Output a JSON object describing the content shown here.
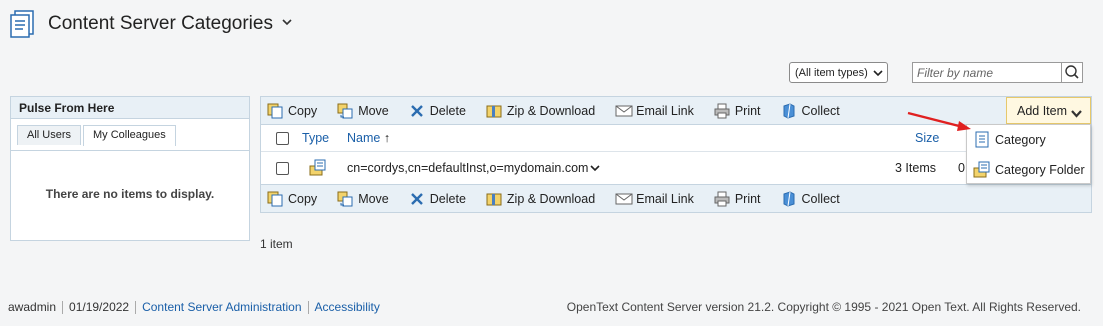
{
  "header": {
    "title": "Content Server Categories",
    "icon": "folder-page-icon"
  },
  "filters": {
    "item_types_value": "(All item types)",
    "filter_placeholder": "Filter by name"
  },
  "pulse": {
    "title": "Pulse From Here",
    "tabs": [
      "All Users",
      "My Colleagues"
    ],
    "active_tab": "My Colleagues",
    "empty_message": "There are no items to display."
  },
  "toolbar": {
    "copy": "Copy",
    "move": "Move",
    "delete": "Delete",
    "zip_download": "Zip & Download",
    "email_link": "Email Link",
    "print": "Print",
    "collect": "Collect"
  },
  "table": {
    "columns": {
      "type": "Type",
      "name": "Name",
      "size": "Size"
    },
    "rows": [
      {
        "name": "cn=cordys,cn=defaultInst,o=mydomain.com",
        "size": "3 Items",
        "extra": "0"
      }
    ]
  },
  "add_item": {
    "label": "Add Item",
    "menu": [
      "Category",
      "Category Folder"
    ]
  },
  "item_count": "1 item",
  "footer": {
    "user": "awadmin",
    "date": "01/19/2022",
    "admin_link": "Content Server Administration",
    "accessibility_link": "Accessibility",
    "copyright": "OpenText Content Server version 21.2. Copyright © 1995 - 2021 Open Text. All Rights Reserved."
  },
  "colors": {
    "link": "#1a5fa8",
    "toolbar_bg": "#e8f0f6",
    "add_item_bg": "#fff8e1",
    "arrow": "#e02020"
  }
}
